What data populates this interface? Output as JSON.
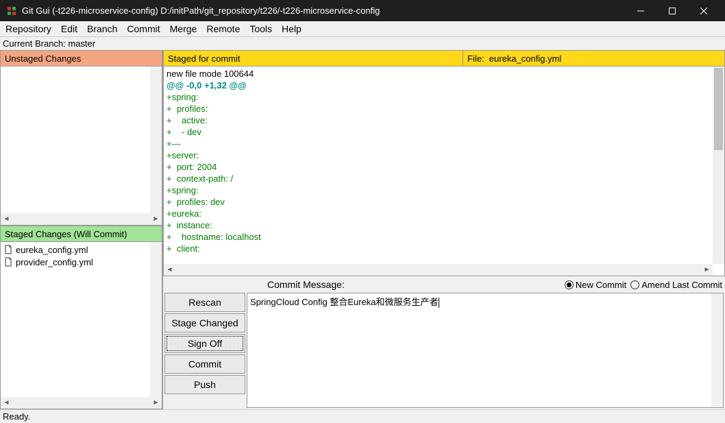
{
  "window": {
    "title": "Git Gui (-t226-microservice-config) D:/initPath/git_repository/t226/-t226-microservice-config"
  },
  "menu": {
    "items": [
      "Repository",
      "Edit",
      "Branch",
      "Commit",
      "Merge",
      "Remote",
      "Tools",
      "Help"
    ]
  },
  "branch": {
    "label": "Current Branch: master"
  },
  "panels": {
    "unstaged_header": "Unstaged Changes",
    "staged_header": "Staged Changes (Will Commit)",
    "diff_header_left": "Staged for commit",
    "diff_header_file_label": "File:",
    "diff_header_file_name": "eureka_config.yml"
  },
  "staged_files": [
    {
      "name": "eureka_config.yml"
    },
    {
      "name": "provider_config.yml"
    }
  ],
  "diff": {
    "lines": [
      {
        "txt": "new file mode 100644",
        "cls": "dl-plain"
      },
      {
        "txt": "@@ -0,0 +1,32 @@",
        "cls": "dl-hunk"
      },
      {
        "txt": "+spring:",
        "cls": "dl-add"
      },
      {
        "txt": "+  profiles:",
        "cls": "dl-add"
      },
      {
        "txt": "+    active:",
        "cls": "dl-add"
      },
      {
        "txt": "+    - dev",
        "cls": "dl-add"
      },
      {
        "txt": "+---",
        "cls": "dl-add"
      },
      {
        "txt": "+server:",
        "cls": "dl-add"
      },
      {
        "txt": "+  port: 2004",
        "cls": "dl-add"
      },
      {
        "txt": "+  context-path: /",
        "cls": "dl-add"
      },
      {
        "txt": "+spring:",
        "cls": "dl-add"
      },
      {
        "txt": "+  profiles: dev",
        "cls": "dl-add"
      },
      {
        "txt": "+eureka:",
        "cls": "dl-add"
      },
      {
        "txt": "+  instance:",
        "cls": "dl-add"
      },
      {
        "txt": "+    hostname: localhost",
        "cls": "dl-add"
      },
      {
        "txt": "+  client:",
        "cls": "dl-add"
      }
    ]
  },
  "commit": {
    "label": "Commit Message:",
    "radio_new": "New Commit",
    "radio_amend": "Amend Last Commit",
    "buttons": {
      "rescan": "Rescan",
      "stage": "Stage Changed",
      "signoff": "Sign Off",
      "commit": "Commit",
      "push": "Push"
    },
    "message": "SpringCloud Config 整合Eureka和微服务生产者"
  },
  "status": {
    "text": "Ready."
  }
}
